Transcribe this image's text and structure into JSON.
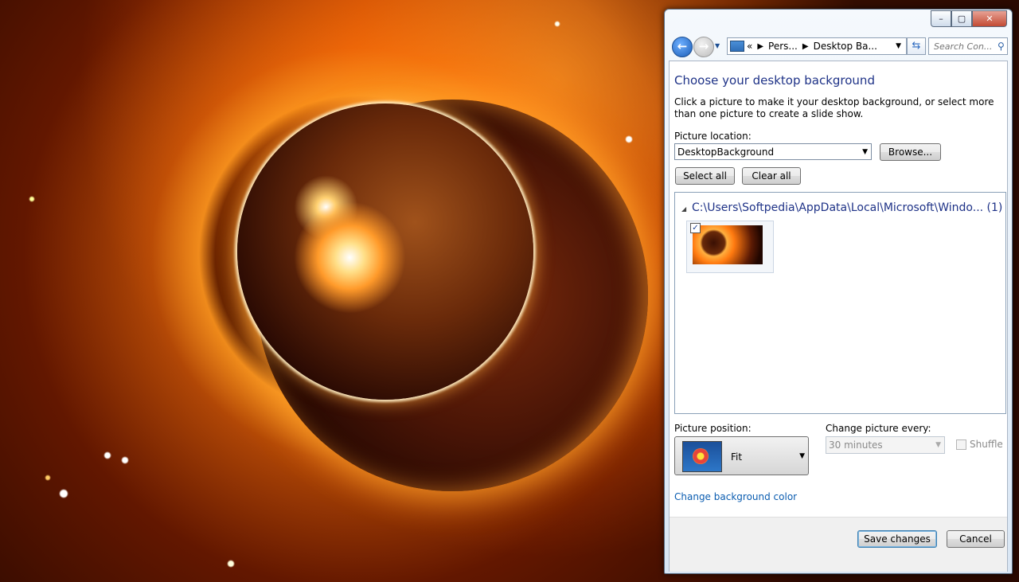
{
  "window": {
    "caption": {
      "minimize": "–",
      "maximize": "▢",
      "close": "✕"
    }
  },
  "navbar": {
    "back_glyph": "←",
    "forward_glyph": "→",
    "breadcrumb_prefix": "«",
    "breadcrumb": [
      "Pers...",
      "Desktop Ba..."
    ],
    "search_placeholder": "Search Con..."
  },
  "main": {
    "title": "Choose your desktop background",
    "description": "Click a picture to make it your desktop background, or select more than one picture to create a slide show.",
    "picture_location_label": "Picture location:",
    "picture_location_value": "DesktopBackground",
    "browse_label": "Browse...",
    "select_all_label": "Select all",
    "clear_all_label": "Clear all",
    "group": {
      "path": "C:\\Users\\Softpedia\\AppData\\Local\\Microsoft\\Windo... (1)",
      "items": [
        {
          "checked": true
        }
      ]
    },
    "picture_position_label": "Picture position:",
    "picture_position_value": "Fit",
    "change_every_label": "Change picture every:",
    "change_every_value": "30 minutes",
    "shuffle_label": "Shuffle",
    "bg_color_link": "Change background color",
    "save_label": "Save changes",
    "cancel_label": "Cancel"
  },
  "colors": {
    "title": "#1e3287",
    "link": "#0a5cb0",
    "disabled_text": "#8a8a8a"
  }
}
